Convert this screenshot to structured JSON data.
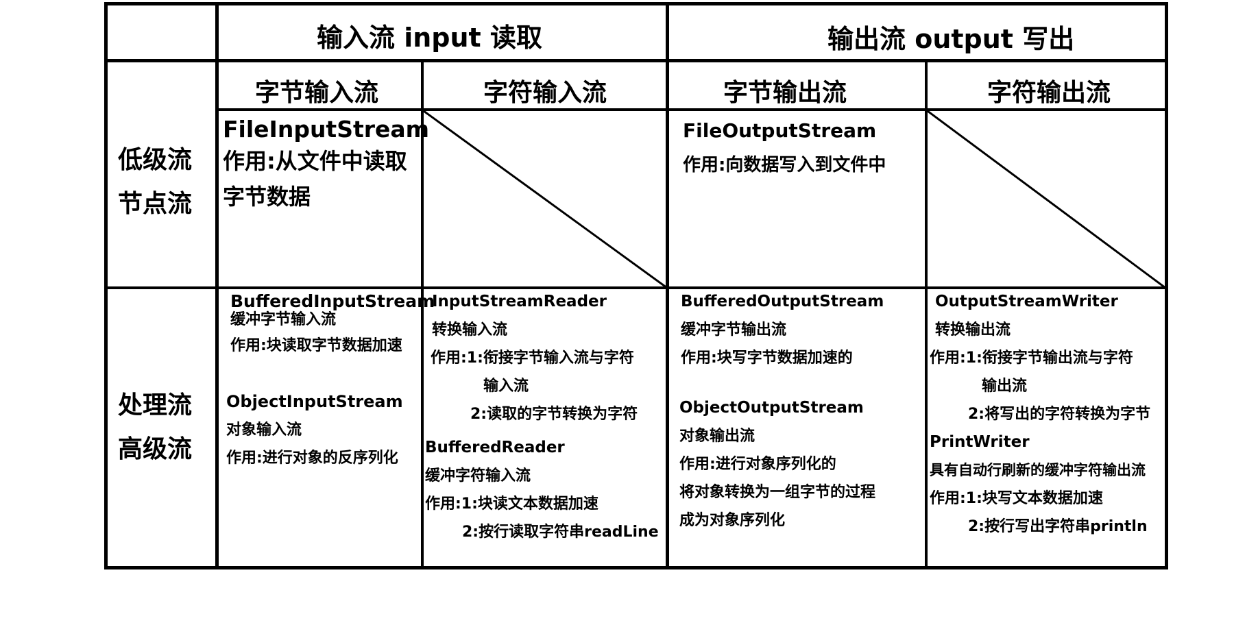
{
  "header": {
    "input": "输入流 input  读取",
    "output": "输出流 output  写出",
    "byte_input": "字节输入流",
    "char_input": "字符输入流",
    "byte_output": "字节输出流",
    "char_output": "字符输出流"
  },
  "rows": {
    "low": [
      "低级流",
      "节点流"
    ],
    "high": [
      "处理流",
      "高级流"
    ]
  },
  "low_cells": {
    "byte_input": [
      "FileInputStream",
      "作用:从文件中读取",
      "字节数据"
    ],
    "byte_output": [
      "FileOutputStream",
      "作用:向数据写入到文件中"
    ]
  },
  "high_cells": {
    "byte_input": [
      "BufferedInputStream",
      "缓冲字节输入流",
      "作用:块读取字节数据加速",
      "ObjectInputStream",
      "对象输入流",
      "作用:进行对象的反序列化"
    ],
    "char_input": [
      "InputStreamReader",
      "转换输入流",
      "作用:1:衔接字节输入流与字符",
      "输入流",
      "2:读取的字节转换为字符",
      "BufferedReader",
      "缓冲字符输入流",
      "作用:1:块读文本数据加速",
      "2:按行读取字符串readLine"
    ],
    "byte_output": [
      "BufferedOutputStream",
      "缓冲字节输出流",
      "作用:块写字节数据加速的",
      "ObjectOutputStream",
      "对象输出流",
      "作用:进行对象序列化的",
      "将对象转换为一组字节的过程",
      "成为对象序列化"
    ],
    "char_output": [
      "OutputStreamWriter",
      "转换输出流",
      "作用:1:衔接字节输出流与字符",
      "输出流",
      "2:将写出的字符转换为字节",
      "PrintWriter",
      "具有自动行刷新的缓冲字符输出流",
      "作用:1:块写文本数据加速",
      "2:按行写出字符串println"
    ]
  }
}
